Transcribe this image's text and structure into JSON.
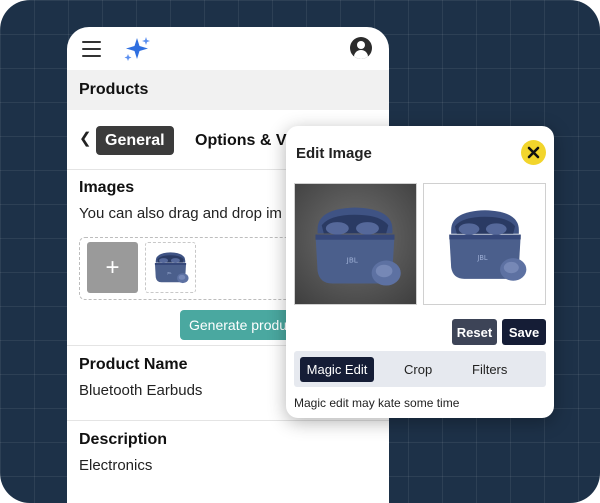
{
  "app": {
    "menu_icon": "hamburger-menu-icon",
    "logo_icon": "sparkle-icon",
    "account_icon": "user-account-icon"
  },
  "header": {
    "title": "Products"
  },
  "tabs": {
    "back_icon": "chevron-left-icon",
    "general": "General",
    "options": "Options & Va"
  },
  "images": {
    "title": "Images",
    "hint": "You can also drag and drop im",
    "add_symbol": "+",
    "generate_label": "Generate produ"
  },
  "fields": [
    {
      "label": "Product Name",
      "value": "Bluetooth Earbuds"
    },
    {
      "label": "Description",
      "value": "Electronics"
    }
  ],
  "modal": {
    "title": "Edit Image",
    "close_symbol": "✖",
    "reset_label": "Reset",
    "save_label": "Save",
    "modes": [
      "Magic Edit",
      "Crop",
      "Filters"
    ],
    "note": "Magic edit may kate some time"
  },
  "colors": {
    "background": "#1d3148",
    "accent_teal": "#4aa8a0",
    "dark_navy": "#151d36",
    "close_yellow": "#f2d52c",
    "product_blue": "#4b5f8c"
  }
}
